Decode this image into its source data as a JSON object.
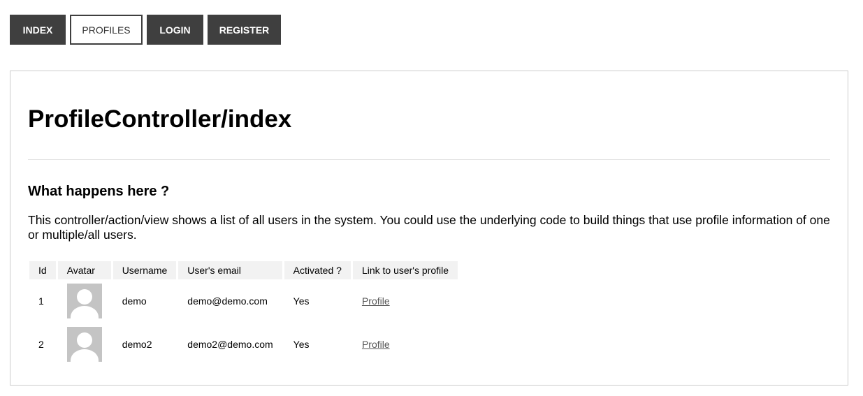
{
  "nav": {
    "items": [
      {
        "label": "INDEX",
        "active": false
      },
      {
        "label": "PROFILES",
        "active": true
      },
      {
        "label": "LOGIN",
        "active": false
      },
      {
        "label": "REGISTER",
        "active": false
      }
    ]
  },
  "main": {
    "title": "ProfileController/index",
    "subheading": "What happens here ?",
    "description": "This controller/action/view shows a list of all users in the system. You could use the underlying code to build things that use profile information of one or multiple/all users."
  },
  "table": {
    "headers": [
      "Id",
      "Avatar",
      "Username",
      "User's email",
      "Activated ?",
      "Link to user's profile"
    ],
    "rows": [
      {
        "id": "1",
        "avatar": "avatar-placeholder-icon",
        "username": "demo",
        "email": "demo@demo.com",
        "activated": "Yes",
        "link": "Profile"
      },
      {
        "id": "2",
        "avatar": "avatar-placeholder-icon",
        "username": "demo2",
        "email": "demo2@demo.com",
        "activated": "Yes",
        "link": "Profile"
      }
    ]
  },
  "colors": {
    "nav_bg": "#3f3f3f",
    "nav_text": "#ffffff",
    "header_bg": "#f2f2f2",
    "avatar_bg": "#c4c4c4"
  }
}
